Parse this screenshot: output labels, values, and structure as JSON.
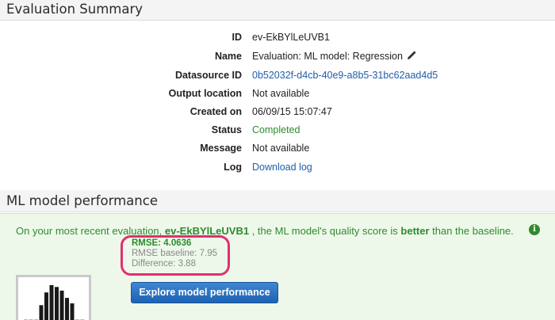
{
  "evaluation_summary": {
    "title": "Evaluation Summary",
    "fields": [
      {
        "label": "ID",
        "value": "ev-EkBYlLeUVB1"
      },
      {
        "label": "Name",
        "value": "Evaluation: ML model: Regression"
      },
      {
        "label": "Datasource ID",
        "value": "0b52032f-d4cb-40e9-a8b5-31bc62aad4d5"
      },
      {
        "label": "Output location",
        "value": "Not available"
      },
      {
        "label": "Created on",
        "value": "06/09/15 15:07:47"
      },
      {
        "label": "Status",
        "value": "Completed"
      },
      {
        "label": "Message",
        "value": "Not available"
      },
      {
        "label": "Log",
        "value": "Download log"
      }
    ]
  },
  "ml_performance": {
    "title": "ML model performance",
    "summary_prefix": "On your most recent evaluation, ",
    "summary_eval_id": "ev-EkBYlLeUVB1",
    "summary_middle": " , the ML model's quality score is ",
    "summary_emphasis": "better",
    "summary_suffix": " than the baseline.",
    "rmse": "RMSE: 4.0636",
    "rmse_baseline": "RMSE baseline: 7.95",
    "difference": "Difference: 3.88",
    "explore_button": "Explore model performance",
    "histogram_bars": [
      0.05,
      0.05,
      0.05,
      0.45,
      0.8,
      1.0,
      0.95,
      0.85,
      0.65,
      0.5,
      0.05,
      0.05
    ]
  },
  "colors": {
    "success_green": "#2e8b2e",
    "link_blue": "#1f5dab",
    "highlight_pink": "#e0306e",
    "button_blue": "#2a6fc1"
  },
  "icons": {
    "edit": "pencil-icon",
    "info": "info-icon"
  }
}
